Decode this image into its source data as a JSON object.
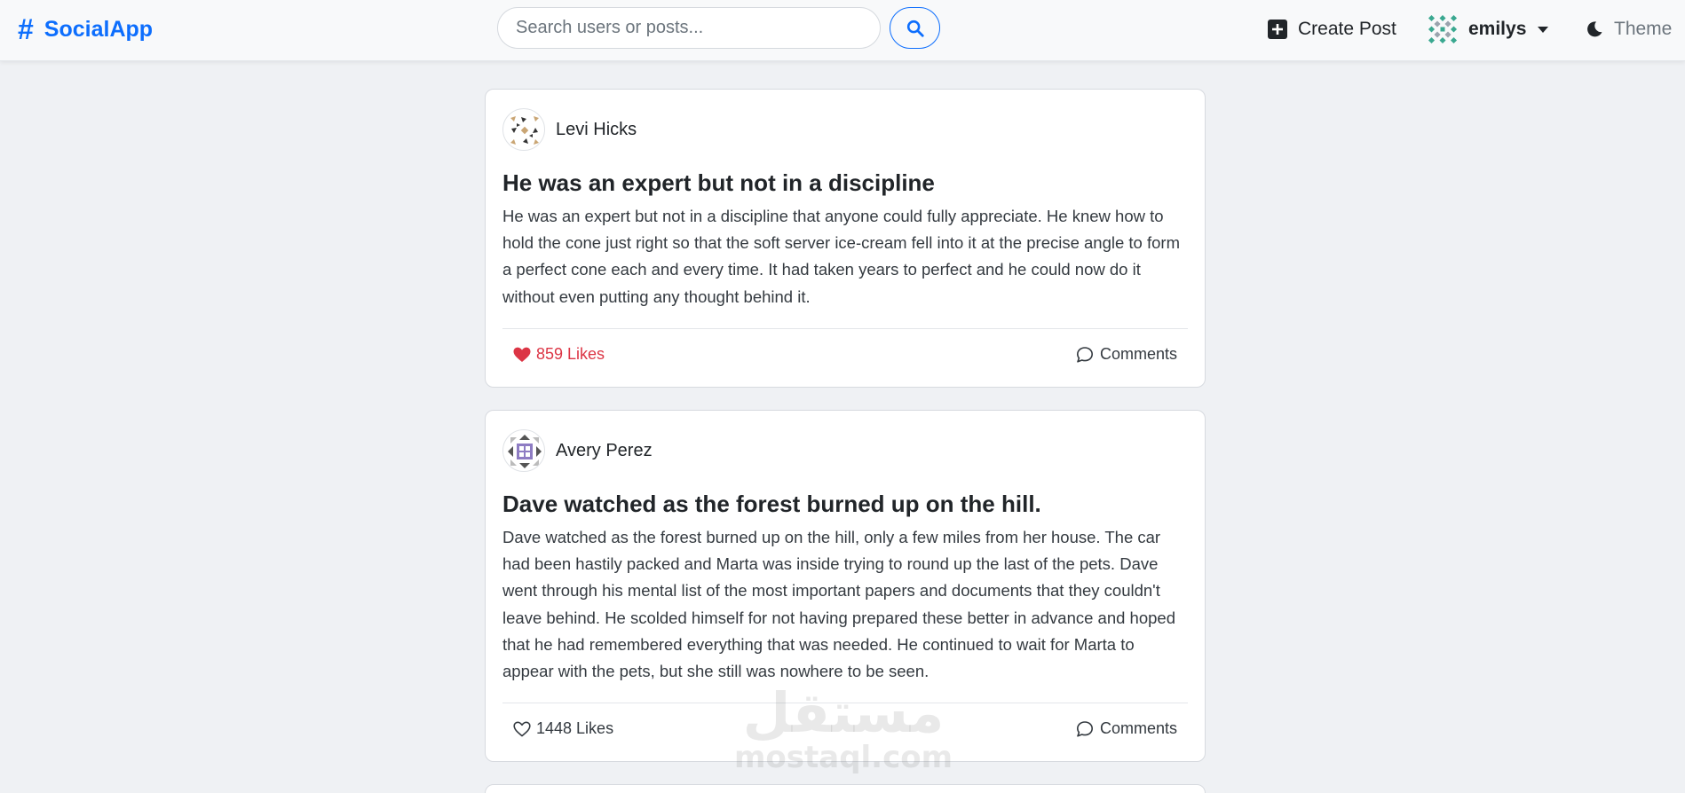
{
  "brand": {
    "icon": "hash-icon",
    "name": "SocialApp",
    "color": "#0d6efd"
  },
  "search": {
    "placeholder": "Search users or posts...",
    "value": "",
    "button_icon": "search-icon"
  },
  "nav": {
    "create_post": {
      "icon": "plus-square-icon",
      "label": "Create Post"
    },
    "user": {
      "avatar": "identicon-avatar",
      "username": "emilys",
      "caret": "caret-down-icon"
    },
    "theme": {
      "icon": "moon-icon",
      "label": "Theme"
    }
  },
  "posts": [
    {
      "author": "Levi Hicks",
      "avatar": "identicon-avatar",
      "title": "He was an expert but not in a discipline",
      "body": "He was an expert but not in a discipline that anyone could fully appreciate. He knew how to hold the cone just right so that the soft server ice-cream fell into it at the precise angle to form a perfect cone each and every time. It had taken years to perfect and he could now do it without even putting any thought behind it.",
      "likes_label": "859 Likes",
      "liked": true,
      "comments_label": "Comments"
    },
    {
      "author": "Avery Perez",
      "avatar": "identicon-avatar",
      "title": "Dave watched as the forest burned up on the hill.",
      "body": "Dave watched as the forest burned up on the hill, only a few miles from her house. The car had been hastily packed and Marta was inside trying to round up the last of the pets. Dave went through his mental list of the most important papers and documents that they couldn't leave behind. He scolded himself for not having prepared these better in advance and hoped that he had remembered everything that was needed. He continued to wait for Marta to appear with the pets, but she still was nowhere to be seen.",
      "likes_label": "1448 Likes",
      "liked": false,
      "comments_label": "Comments"
    }
  ],
  "watermark": {
    "arabic": "مستقل",
    "latin": "mostaql.com"
  },
  "colors": {
    "liked": "#dc3545",
    "accent": "#0d6efd",
    "background": "#eff1f4"
  }
}
